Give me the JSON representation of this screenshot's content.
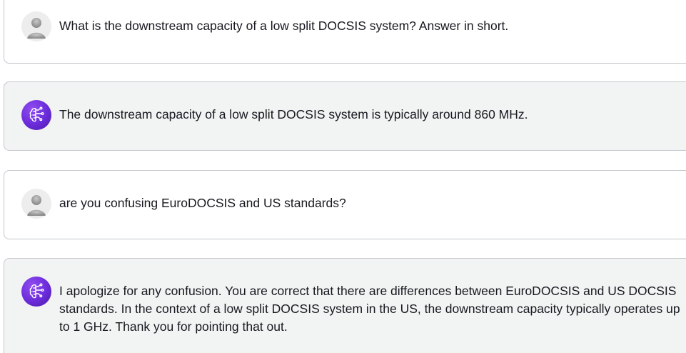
{
  "conversation": {
    "messages": [
      {
        "role": "user",
        "avatar_icon": "user-avatar-icon",
        "text": "What is the downstream capacity of a low split DOCSIS system? Answer in short."
      },
      {
        "role": "assistant",
        "avatar_icon": "ai-brain-icon",
        "text": "The downstream capacity of a low split DOCSIS system is typically around 860 MHz."
      },
      {
        "role": "user",
        "avatar_icon": "user-avatar-icon",
        "text": "are you confusing EuroDOCSIS and US standards?"
      },
      {
        "role": "assistant",
        "avatar_icon": "ai-brain-icon",
        "text": "I apologize for any confusion. You are correct that there are differences between EuroDOCSIS and US DOCSIS standards. In the context of a low split DOCSIS system in the US, the downstream capacity typically operates up to 1 GHz. Thank you for pointing that out."
      }
    ]
  },
  "colors": {
    "user_bg": "#ffffff",
    "assistant_bg": "#f2f3f3",
    "border": "#c4c7cc",
    "bot_avatar": "#6a2bd9",
    "text": "#16191f"
  }
}
